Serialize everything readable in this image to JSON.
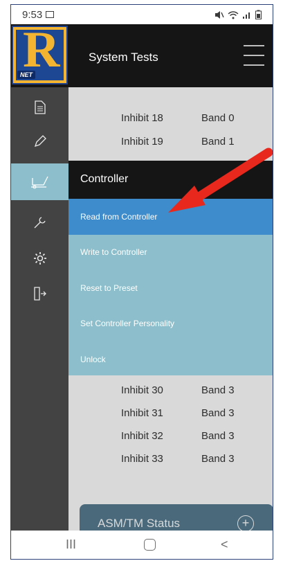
{
  "status_bar": {
    "time": "9:53",
    "icons": [
      "image-icon",
      "mute-icon",
      "wifi-icon",
      "signal-icon",
      "battery-icon"
    ]
  },
  "header": {
    "title": "System Tests",
    "logo_letter": "R",
    "logo_sub": "NET"
  },
  "sidebar": {
    "items": [
      {
        "icon": "document-icon"
      },
      {
        "icon": "pencil-icon"
      },
      {
        "icon": "chair-icon",
        "active": true
      },
      {
        "icon": "wrench-icon"
      },
      {
        "icon": "settings-icon"
      },
      {
        "icon": "exit-icon"
      }
    ]
  },
  "content": {
    "rows": [
      {
        "inhibit": "Inhibit 18",
        "band": "Band 0"
      },
      {
        "inhibit": "Inhibit 19",
        "band": "Band 1"
      },
      {
        "inhibit": "Inhibit 30",
        "band": "Band 3"
      },
      {
        "inhibit": "Inhibit 31",
        "band": "Band 3"
      },
      {
        "inhibit": "Inhibit 32",
        "band": "Band 3"
      },
      {
        "inhibit": "Inhibit 33",
        "band": "Band 3"
      }
    ],
    "asm_card": {
      "label": "ASM/TM Status",
      "plus": "+"
    }
  },
  "dropdown": {
    "title": "Controller",
    "items": [
      {
        "label": "Read from Controller",
        "selected": true
      },
      {
        "label": "Write to Controller"
      },
      {
        "label": "Reset to Preset"
      },
      {
        "label": "Set Controller Personality"
      },
      {
        "label": "Unlock"
      }
    ]
  },
  "navbar": {
    "recents": "III",
    "back": "<"
  },
  "colors": {
    "header_bg": "#151515",
    "sidebar_bg": "#434343",
    "accent_teal": "#8cbfcb",
    "selected_blue": "#3e8ccb",
    "arrow_red": "#e8281c",
    "logo_gold": "#f3b431",
    "logo_blue": "#1d4693"
  }
}
